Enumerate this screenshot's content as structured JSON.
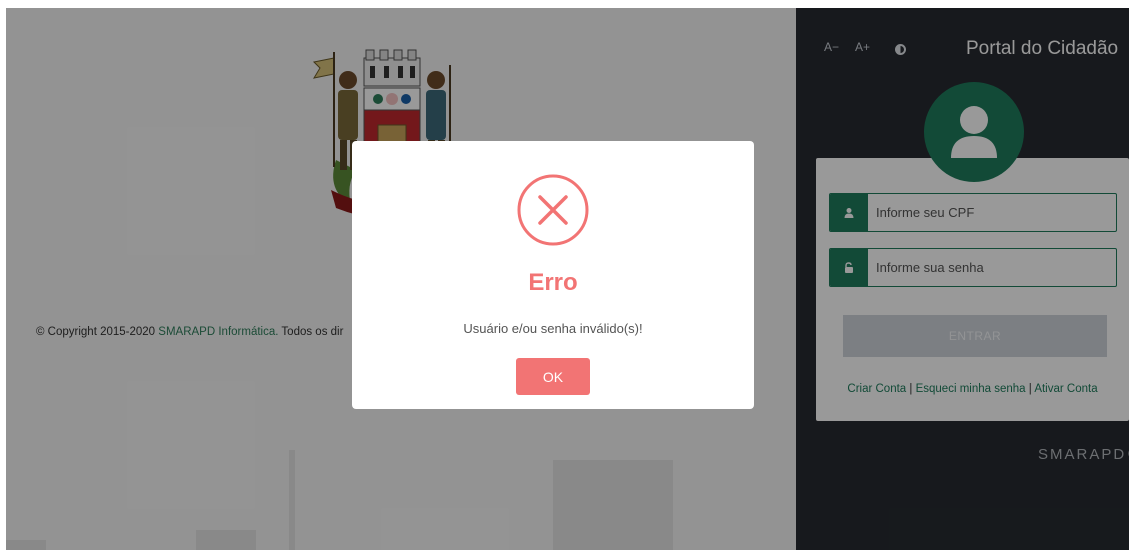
{
  "footer": {
    "copyright_prefix": "© Copyright 2015-2020 ",
    "brand": "SMARAPD Informática.",
    "suffix": " Todos os dir"
  },
  "panel": {
    "font_decrease": "A−",
    "font_increase": "A+",
    "contrast_icon": "contrast-icon",
    "title": "Portal do Cidadão",
    "cpf_placeholder": "Informe seu CPF",
    "password_placeholder": "Informe sua senha",
    "login_button": "ENTRAR",
    "links": {
      "create_account": "Criar Conta",
      "forgot_password": "Esqueci minha senha",
      "activate_account": "Ativar Conta",
      "separator": " | "
    },
    "logo_text": "SMARAPD"
  },
  "modal": {
    "title": "Erro",
    "message": "Usuário e/ou senha inválido(s)!",
    "ok_label": "OK",
    "icon": "error-x-icon"
  },
  "colors": {
    "accent_green": "#1e7c5c",
    "panel_dark": "#272b31",
    "error_red": "#f27474",
    "disabled_button": "#cfd4da"
  }
}
